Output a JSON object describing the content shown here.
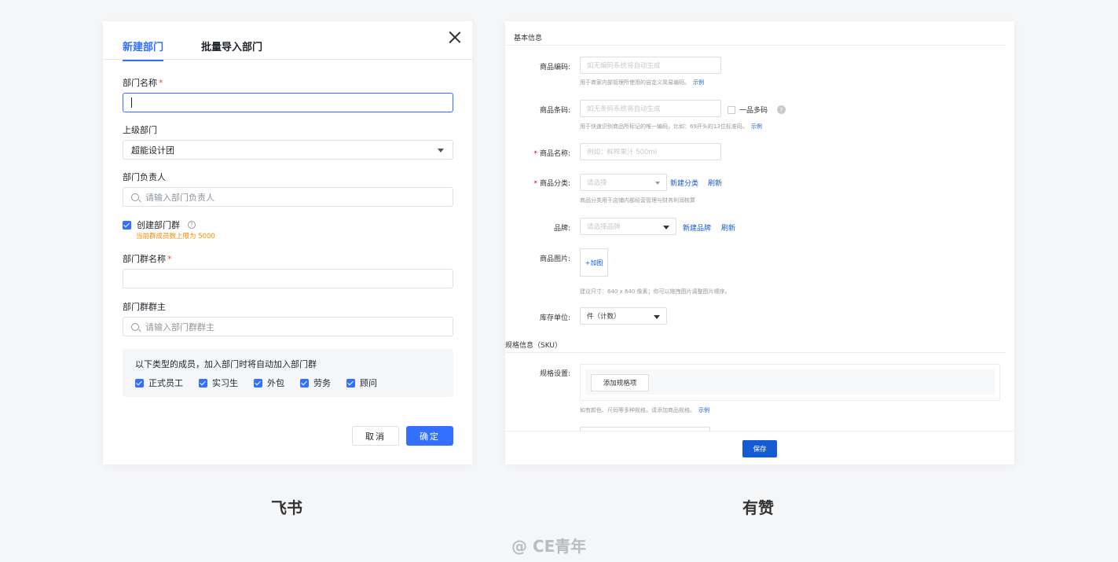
{
  "feishu": {
    "tabs": [
      {
        "label": "新建部门"
      },
      {
        "label": "批量导入部门"
      }
    ],
    "dept_name": {
      "label": "部门名称",
      "required": "*"
    },
    "parent_dept": {
      "label": "上级部门",
      "value": "超能设计团"
    },
    "dept_leader": {
      "label": "部门负责人",
      "placeholder": "请输入部门负责人"
    },
    "create_group": {
      "label": "创建部门群",
      "help": "?",
      "hint": "当前群成员数上限为 5000"
    },
    "group_name": {
      "label": "部门群名称",
      "required": "*"
    },
    "group_owner": {
      "label": "部门群群主",
      "placeholder": "请输入部门群群主"
    },
    "auto_join": {
      "title": "以下类型的成员，加入部门时将自动加入部门群",
      "options": [
        {
          "label": "正式员工"
        },
        {
          "label": "实习生"
        },
        {
          "label": "外包"
        },
        {
          "label": "劳务"
        },
        {
          "label": "顾问"
        }
      ]
    },
    "cancel_label": "取消",
    "ok_label": "确定"
  },
  "youzan": {
    "basic_title": "基本信息",
    "code": {
      "label": "商品编码:",
      "placeholder": "如无编码系统将自动生成",
      "hint": "用于商家内部管理所使用的自定义简易编码。",
      "link": "示例"
    },
    "barcode": {
      "label": "商品条码:",
      "placeholder": "如无条码系统将自动生成",
      "multi": "一品多码",
      "help": "?",
      "hint": "用于快速识别商品所标记的唯一编码，比如：69开头的13位标准码。",
      "link": "示例"
    },
    "name": {
      "star": "*",
      "label": "商品名称:",
      "placeholder": "例如：鲜榨果汁 500ml"
    },
    "category": {
      "star": "*",
      "label": "商品分类:",
      "placeholder": "请选择",
      "new_link": "新建分类",
      "refresh": "刷新",
      "hint": "商品分类用于店铺内部经营管理与财务利润核算"
    },
    "brand": {
      "label": "品牌:",
      "placeholder": "请选择品牌",
      "new_link": "新建品牌",
      "refresh": "刷新"
    },
    "image": {
      "label": "商品图片:",
      "add": "+加图",
      "hint": "建议尺寸：640 x 640 像素；你可以拖拽图片调整图片顺序。"
    },
    "unit": {
      "label": "库存单位:",
      "value": "件（计数）"
    },
    "sku_title": "规格信息（SKU）",
    "spec": {
      "label": "规格设置:",
      "button": "添加规格项",
      "hint": "如有颜色、尺码等多种规格，请添加商品规格。",
      "link": "示例"
    },
    "save_label": "保存"
  },
  "captions": {
    "left": "飞书",
    "right": "有赞"
  },
  "watermark": "@ CE青年",
  "colors": {
    "feishu_blue": "#3370ff",
    "youzan_blue": "#155bd4",
    "orange_hint": "#ff8800",
    "required_red": "#f54a45"
  }
}
